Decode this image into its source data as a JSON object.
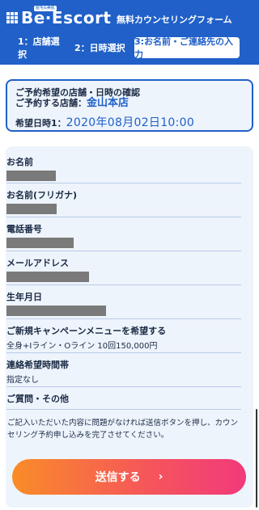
{
  "header": {
    "brand": "Be·Escort",
    "brand_tag": "脱毛&美肌",
    "subtitle": "無料カウンセリングフォーム"
  },
  "steps": [
    {
      "label": "1：店舗選択",
      "active": false
    },
    {
      "label": "2：日時選択",
      "active": false
    },
    {
      "label": "3:お名前・ご連絡先の入力",
      "active": true
    }
  ],
  "confirm": {
    "title": "ご予約希望の店舗・日時の確認",
    "shop_label": "ご予約する店舗：",
    "shop": "金山本店",
    "date_label": "希望日時1：",
    "date": "2020年08月02日10:00"
  },
  "fields": [
    {
      "label": "お名前",
      "value": null
    },
    {
      "label": "お名前(フリガナ)",
      "value": null
    },
    {
      "label": "電話番号",
      "value": null
    },
    {
      "label": "メールアドレス",
      "value": null
    },
    {
      "label": "生年月日",
      "value": null
    },
    {
      "label": "ご新規キャンペーンメニューを希望する",
      "value": "全身+Iライン・Oライン 10回150,000円"
    },
    {
      "label": "連絡希望時間帯",
      "value": "指定なし"
    },
    {
      "label": "ご質問・その他",
      "value": ""
    }
  ],
  "note": "ご記入いただいた内容に問題がなければ送信ボタンを押し、カウンセリング予約申し込みを完了させてください。",
  "submit": {
    "label": "送信する",
    "icon": "chevron-right-icon"
  },
  "colors": {
    "brand_blue": "#2060c8",
    "panel": "#eef4fc",
    "button_start": "#f98c28",
    "button_end": "#f13a7c"
  }
}
